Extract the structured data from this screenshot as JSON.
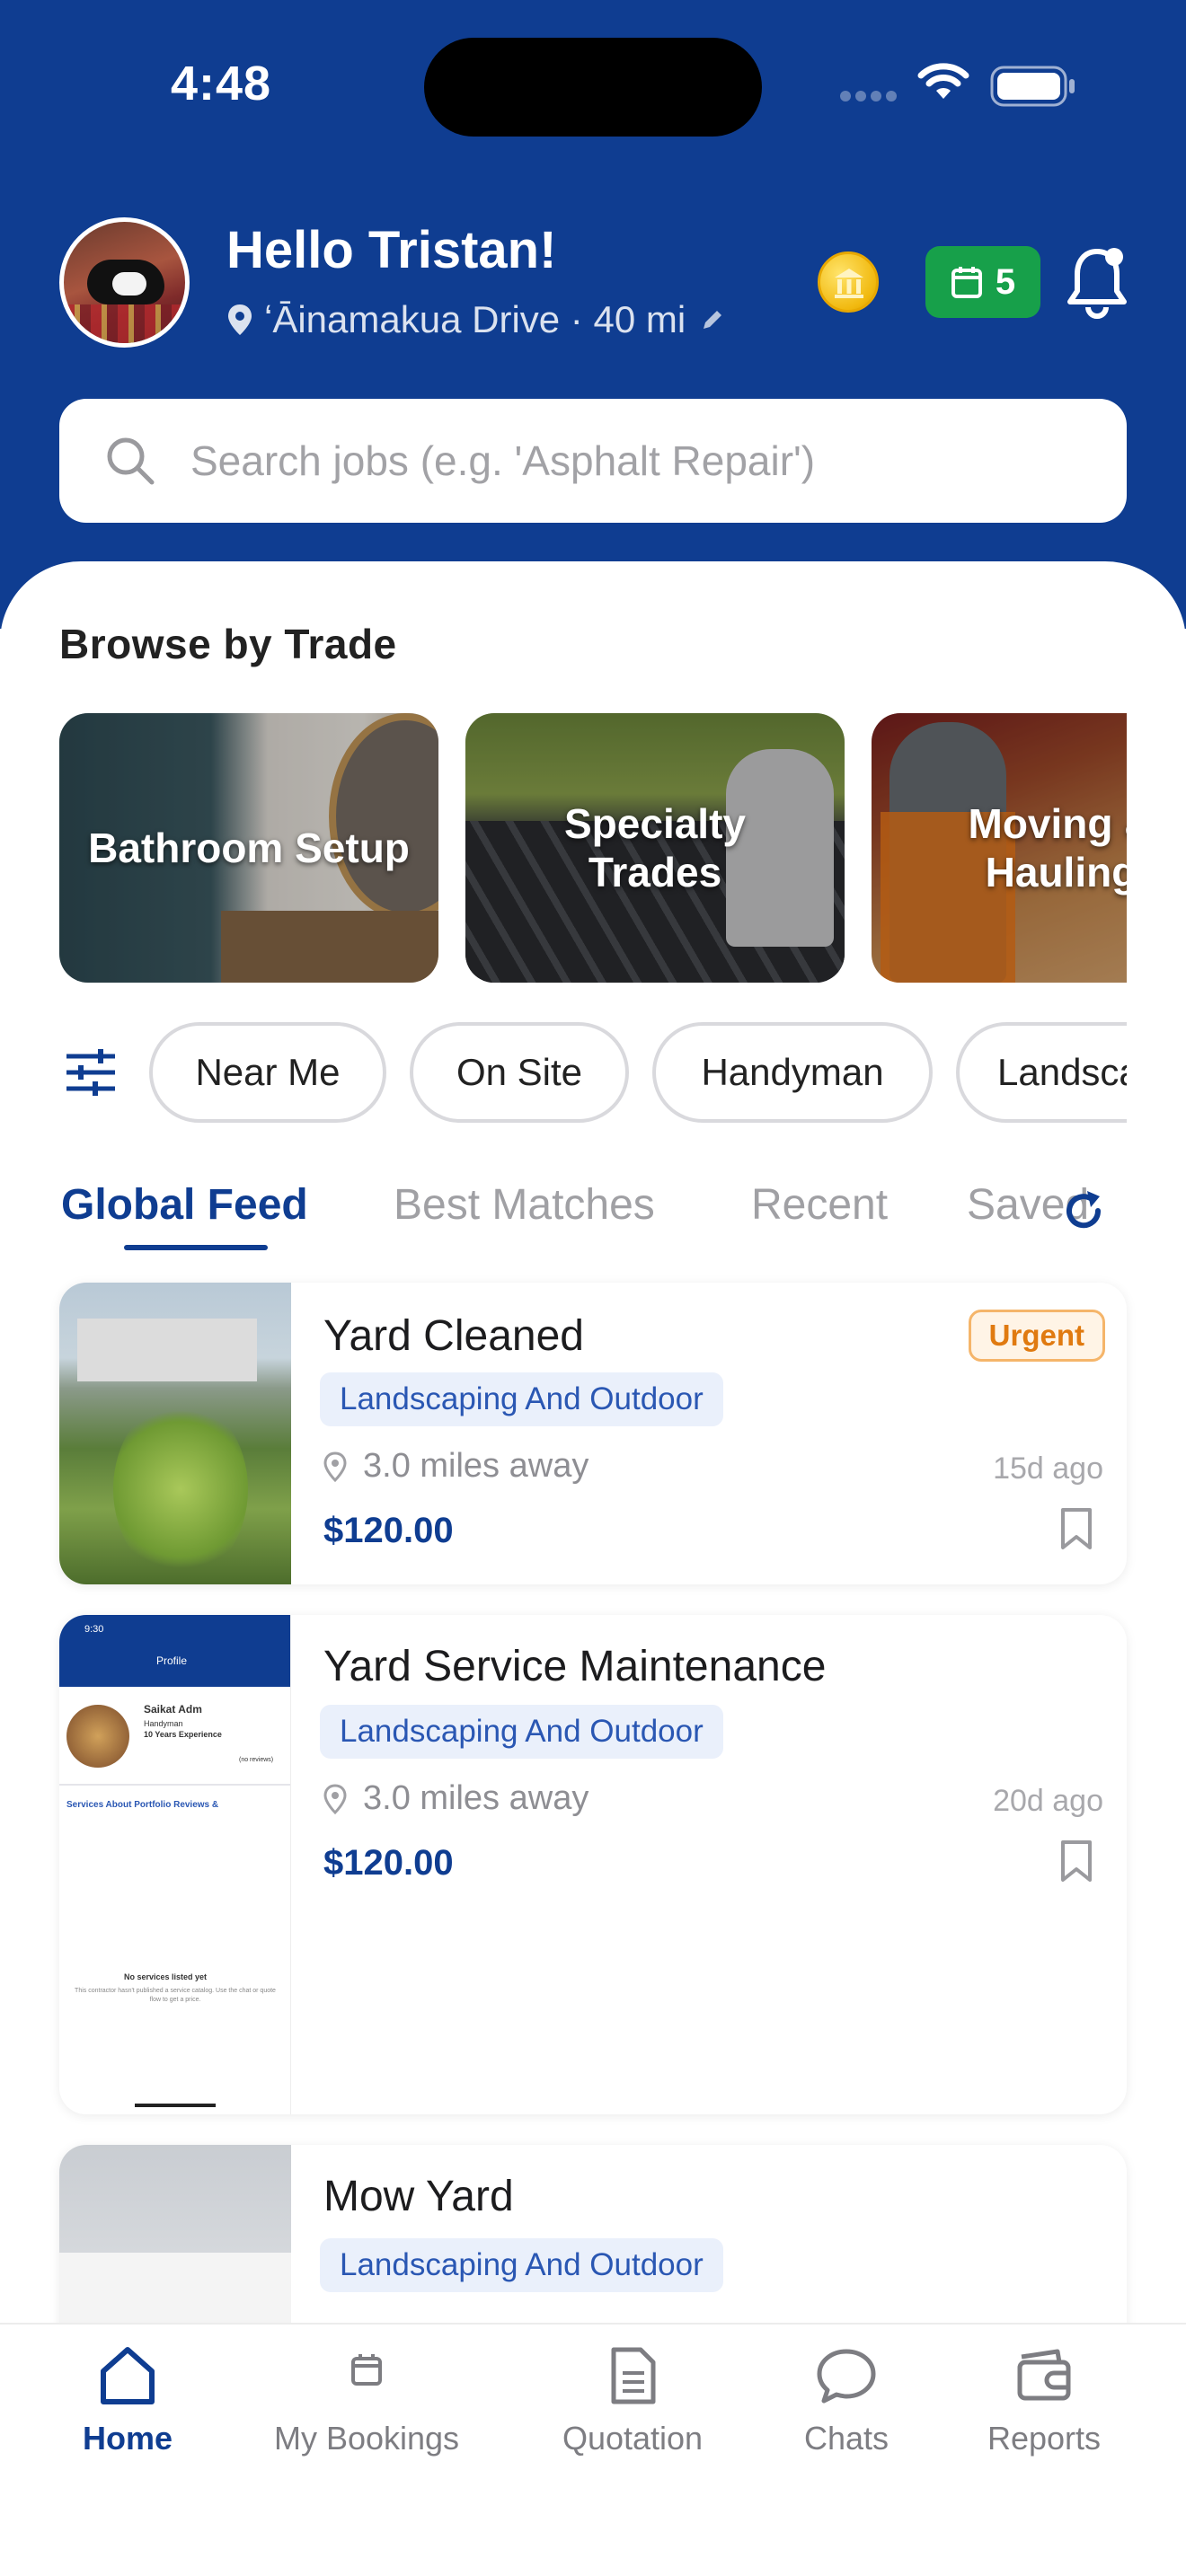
{
  "status_bar": {
    "time": "4:48"
  },
  "header": {
    "greeting": "Hello Tristan!",
    "location": "ʻĀinamakua Drive · 40 mi",
    "bookings_badge_count": "5"
  },
  "search": {
    "placeholder": "Search jobs (e.g. 'Asphalt Repair')"
  },
  "browse": {
    "title": "Browse by Trade",
    "trades": [
      {
        "label": "Bathroom Setup"
      },
      {
        "label": "Specialty\nTrades"
      },
      {
        "label": "Moving &\nHauling"
      }
    ]
  },
  "filters": {
    "chips": [
      "Near Me",
      "On Site",
      "Handyman",
      "Landscaping"
    ]
  },
  "feed_tabs": [
    "Global Feed",
    "Best Matches",
    "Recent",
    "Saved"
  ],
  "jobs": [
    {
      "title": "Yard Cleaned",
      "category": "Landscaping And Outdoor",
      "distance": "3.0 miles away",
      "posted": "15d ago",
      "price": "$120.00",
      "badge": "Urgent"
    },
    {
      "title": "Yard Service Maintenance",
      "category": "Landscaping And Outdoor",
      "distance": "3.0 miles away",
      "posted": "20d ago",
      "price": "$120.00",
      "thumb_text": {
        "time": "9:30",
        "header": "Profile",
        "name": "Saikat Adm",
        "role": "Handyman",
        "experience": "10 Years Experience",
        "reviews": "(no reviews)",
        "tabs": "Services   About   Portfolio   Reviews &",
        "empty_title": "No services listed yet",
        "empty_body": "This contractor hasn't published a service catalog. Use the chat or quote flow to get a price."
      }
    },
    {
      "title": "Mow Yard",
      "category": "Landscaping And Outdoor"
    }
  ],
  "bottom_nav": [
    {
      "label": "Home",
      "icon": "home-icon"
    },
    {
      "label": "My Bookings",
      "icon": "calendar-icon"
    },
    {
      "label": "Quotation",
      "icon": "document-icon"
    },
    {
      "label": "Chats",
      "icon": "chat-bubble-icon"
    },
    {
      "label": "Reports",
      "icon": "wallet-icon"
    }
  ],
  "colors": {
    "brand_blue": "#0f3d91",
    "badge_green": "#17a04a",
    "urgent_orange": "#e07a10",
    "category_chip_bg": "#eaf0fb"
  }
}
